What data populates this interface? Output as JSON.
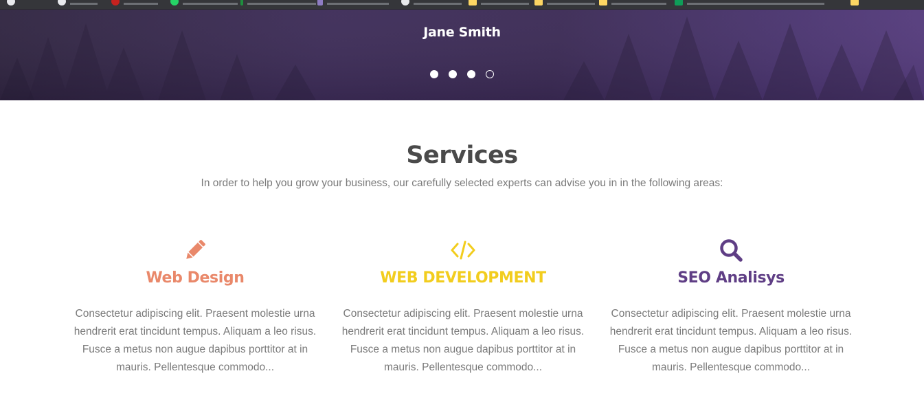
{
  "browser": {
    "bookmarks": [
      {
        "icon": "google-icon",
        "color": "#e8eaed",
        "round": true
      },
      {
        "icon": "google-icon",
        "color": "#e8eaed",
        "round": true
      },
      {
        "icon": "red-favicon-icon",
        "color": "#c5221f",
        "round": true
      },
      {
        "icon": "whatsapp-icon",
        "color": "#25d366",
        "round": true
      },
      {
        "icon": "green-favicon-icon",
        "color": "#1e8e3e",
        "round": false
      },
      {
        "icon": "purple-favicon-icon",
        "color": "#8e7cc3",
        "round": false
      },
      {
        "icon": "google-icon",
        "color": "#e8eaed",
        "round": true
      },
      {
        "icon": "folder-icon",
        "color": "#fdd663",
        "round": false
      },
      {
        "icon": "folder-icon",
        "color": "#fdd663",
        "round": false
      },
      {
        "icon": "folder-icon",
        "color": "#fdd663",
        "round": false
      },
      {
        "icon": "sheets-icon",
        "color": "#0f9d58",
        "round": false
      },
      {
        "icon": "folder-icon",
        "color": "#fdd663",
        "round": false
      }
    ]
  },
  "hero": {
    "name": "Jane Smith",
    "dots_count": 4,
    "active_dot": 4
  },
  "services": {
    "title": "Services",
    "subtitle": "In order to help you grow your business, our carefully selected experts can advise you in in the following areas:",
    "items": [
      {
        "icon": "pencil-icon",
        "title": "Web Design",
        "color": "#e9886a",
        "text": "Consectetur adipiscing elit. Praesent molestie urna hendrerit erat tincidunt tempus. Aliquam a leo risus. Fusce a metus non augue dapibus porttitor at in mauris. Pellentesque commodo..."
      },
      {
        "icon": "code-icon",
        "title": "WEB DEVELOPMENT",
        "color": "#f2cd1e",
        "text": "Consectetur adipiscing elit. Praesent molestie urna hendrerit erat tincidunt tempus. Aliquam a leo risus. Fusce a metus non augue dapibus porttitor at in mauris. Pellentesque commodo..."
      },
      {
        "icon": "search-icon",
        "title": "SEO Analisys",
        "color": "#5f3e85",
        "text": "Consectetur adipiscing elit. Praesent molestie urna hendrerit erat tincidunt tempus. Aliquam a leo risus. Fusce a metus non augue dapibus porttitor at in mauris. Pellentesque commodo..."
      }
    ]
  }
}
